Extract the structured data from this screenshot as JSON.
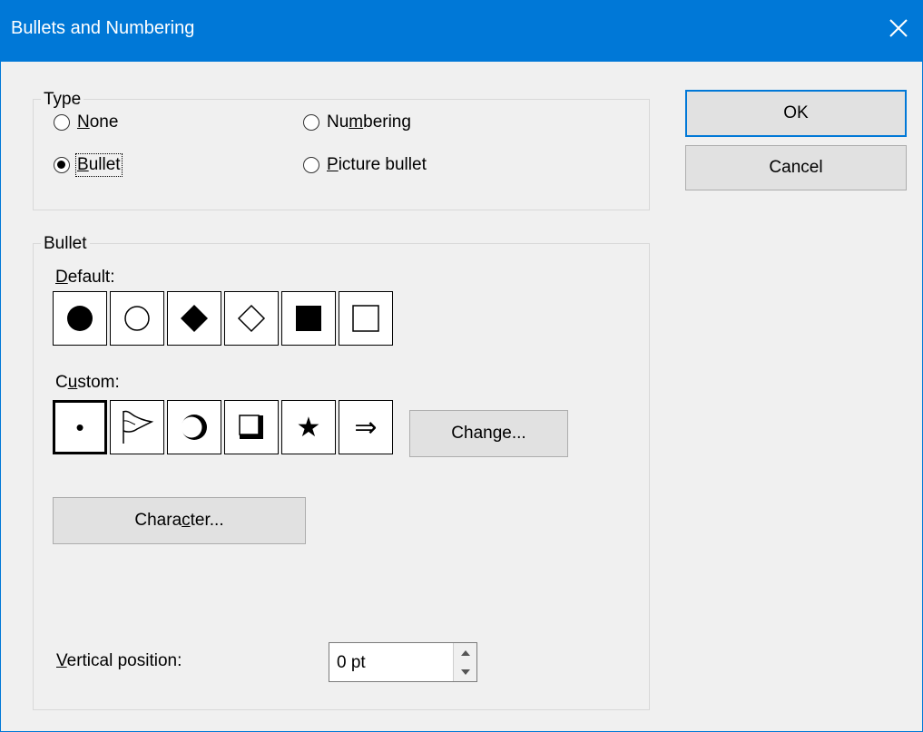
{
  "window": {
    "title": "Bullets and Numbering"
  },
  "type_group": {
    "legend": "Type",
    "options": [
      {
        "label": "None",
        "checked": false
      },
      {
        "label": "Numbering",
        "checked": false
      },
      {
        "label": "Bullet",
        "checked": true
      },
      {
        "label": "Picture bullet",
        "checked": false
      }
    ]
  },
  "bullet_group": {
    "legend": "Bullet",
    "default_label": "Default:",
    "default_bullets": [
      "filled-circle",
      "hollow-circle",
      "filled-diamond",
      "hollow-diamond",
      "filled-square",
      "hollow-square"
    ],
    "custom_label": "Custom:",
    "custom_bullets": [
      {
        "glyph": "•",
        "name": "small-dot",
        "selected": true
      },
      {
        "glyph": "",
        "name": "flag",
        "selected": false
      },
      {
        "glyph": "",
        "name": "shaded-circle",
        "selected": false
      },
      {
        "glyph": "",
        "name": "shadowed-square",
        "selected": false
      },
      {
        "glyph": "★",
        "name": "star",
        "selected": false
      },
      {
        "glyph": "⇒",
        "name": "double-arrow",
        "selected": false
      }
    ],
    "change_button": "Change...",
    "character_button": "Character...",
    "vertical_position_label": "Vertical position:",
    "vertical_position_value": "0 pt"
  },
  "buttons": {
    "ok": "OK",
    "cancel": "Cancel"
  }
}
